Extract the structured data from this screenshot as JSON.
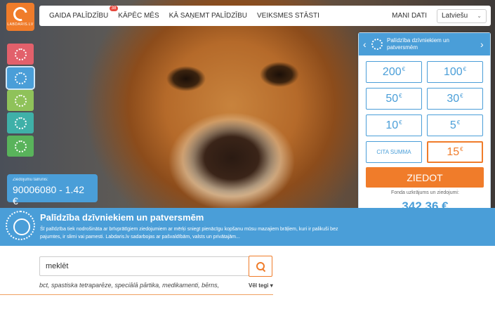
{
  "brand": {
    "logo_text": "LABDARIS.LV",
    "accent": "#f07c2a",
    "primary": "#4a9ed8"
  },
  "nav": {
    "items": [
      {
        "label": "GAIDA PALĪDZĪBU",
        "badge": "38"
      },
      {
        "label": "KĀPĒC MĒS"
      },
      {
        "label": "KĀ SAŅEMT PALĪDZĪBU"
      },
      {
        "label": "VEIKSMES STĀSTI"
      }
    ],
    "my_data": "MANI DATI",
    "language": "Latviešu"
  },
  "categories": [
    {
      "icon": "animal-paw-icon",
      "color": "#e2606b"
    },
    {
      "icon": "animal-paw-icon",
      "color": "#4a9ed8"
    },
    {
      "icon": "leaf-icon",
      "color": "#8fc25a"
    },
    {
      "icon": "leaf-icon",
      "color": "#3fb0a8"
    },
    {
      "icon": "leaf-icon",
      "color": "#59b35b"
    }
  ],
  "phone": {
    "label": "Ziedojumu tālrunis:",
    "number": "90006080 - 1.42 €"
  },
  "donation_panel": {
    "title": "Palīdzība dzīvniekiem un patversmēm",
    "amounts": [
      "200",
      "100",
      "50",
      "30",
      "10",
      "5"
    ],
    "currency": "€",
    "other_label": "CITA SUMMA",
    "selected": "15",
    "donate_label": "ZIEDOT",
    "fund_label": "Fonda uzkrājums un ziedojumi:",
    "fund_value": "342.36 €"
  },
  "info": {
    "title": "Palīdzība dzīvniekiem un patversmēm",
    "description": "Šī palīdzība tiek nodrošināta ar brīvprātīgiem ziedojumiem ar mērķi sniegt pienācīgu kopšanu mūsu mazajiem brāļiem, kuri ir palikuši bez pajumtes, ir slimi vai pamesti. Labdaris.lv sadarbojas ar pašvaldībām, valsts un privātajām..."
  },
  "search": {
    "value": "meklēt",
    "tags": "bct, spastiska tetraparēze, speciālā pārtika, medikamenti, bērns,",
    "more_label": "Vēl tegi"
  }
}
